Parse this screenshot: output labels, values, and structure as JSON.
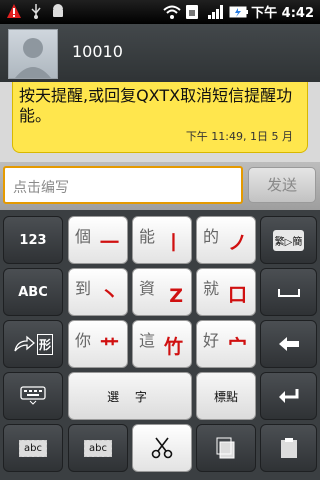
{
  "status_bar": {
    "time": "下午 4:42",
    "icons": [
      "warning-icon",
      "usb-icon",
      "android-icon",
      "wifi-icon",
      "sim-icon",
      "signal-icon",
      "battery-icon"
    ]
  },
  "contact": {
    "number": "10010"
  },
  "message": {
    "text": "按天提醒,或回复QXTX取消短信提醒功能。",
    "timestamp": "下午 11:49, 1日 5 月"
  },
  "compose": {
    "placeholder": "点击编写",
    "send_label": "发送"
  },
  "keyboard": {
    "row1": [
      {
        "cand": "個",
        "stroke": "一"
      },
      {
        "cand": "能",
        "stroke": "丨"
      },
      {
        "cand": "的",
        "stroke": "ノ"
      }
    ],
    "row2": [
      {
        "cand": "到",
        "stroke": "丶"
      },
      {
        "cand": "資",
        "stroke": "Z"
      },
      {
        "cand": "就",
        "stroke": "口"
      }
    ],
    "row3": [
      {
        "cand": "你",
        "stroke": "艹"
      },
      {
        "cand": "這",
        "stroke": "竹"
      },
      {
        "cand": "好",
        "stroke": "宀"
      }
    ],
    "num_label": "123",
    "abc_label": "ABC",
    "shape_label": "形",
    "select_label": "選 字",
    "punct_label": "標點",
    "conv_label": "繁▷簡",
    "abc_small": "abc"
  },
  "colors": {
    "bubble": "#ffe64d",
    "accent": "#e59a00",
    "stroke_red": "#d01010"
  }
}
